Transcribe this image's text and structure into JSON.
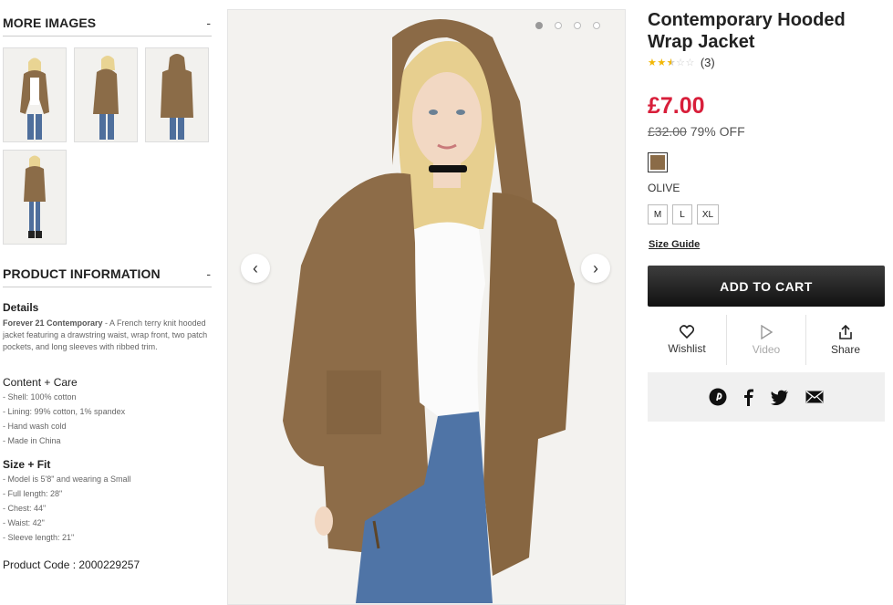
{
  "more_images": {
    "heading": "MORE IMAGES",
    "toggle": "-"
  },
  "product_info": {
    "heading": "PRODUCT INFORMATION",
    "toggle": "-",
    "details_heading": "Details",
    "details_brand": "Forever 21 Contemporary",
    "details_text": " - A French terry knit hooded jacket featuring a drawstring waist, wrap front, two patch pockets, and long sleeves with ribbed trim.",
    "content_heading": "Content + Care",
    "content_items": [
      "- Shell: 100% cotton",
      "- Lining: 99% cotton, 1% spandex",
      "- Hand wash cold",
      "- Made in China"
    ],
    "size_heading": "Size + Fit",
    "size_items": [
      "- Model is 5'8\" and wearing a Small",
      "- Full length: 28\"",
      "- Chest: 44\"",
      "- Waist: 42\"",
      "- Sleeve length: 21\""
    ],
    "product_code": "Product Code : 2000229257"
  },
  "gallery": {
    "arrow_prev": "‹",
    "arrow_next": "›",
    "active_dot": 0
  },
  "product": {
    "title": "Contemporary Hooded Wrap Jacket",
    "rating": 2.5,
    "review_count": "(3)",
    "price": "£7.00",
    "old_price": "£32.00",
    "discount": "79% OFF",
    "swatch_color": "#8a6b47",
    "color_name": "OLIVE",
    "sizes": [
      "M",
      "L",
      "XL"
    ],
    "size_guide": "Size Guide",
    "add_to_cart": "ADD TO CART"
  },
  "actions": {
    "wishlist": "Wishlist",
    "video": "Video",
    "share": "Share"
  },
  "social_icons": [
    "pinterest-icon",
    "facebook-icon",
    "twitter-icon",
    "email-icon"
  ]
}
